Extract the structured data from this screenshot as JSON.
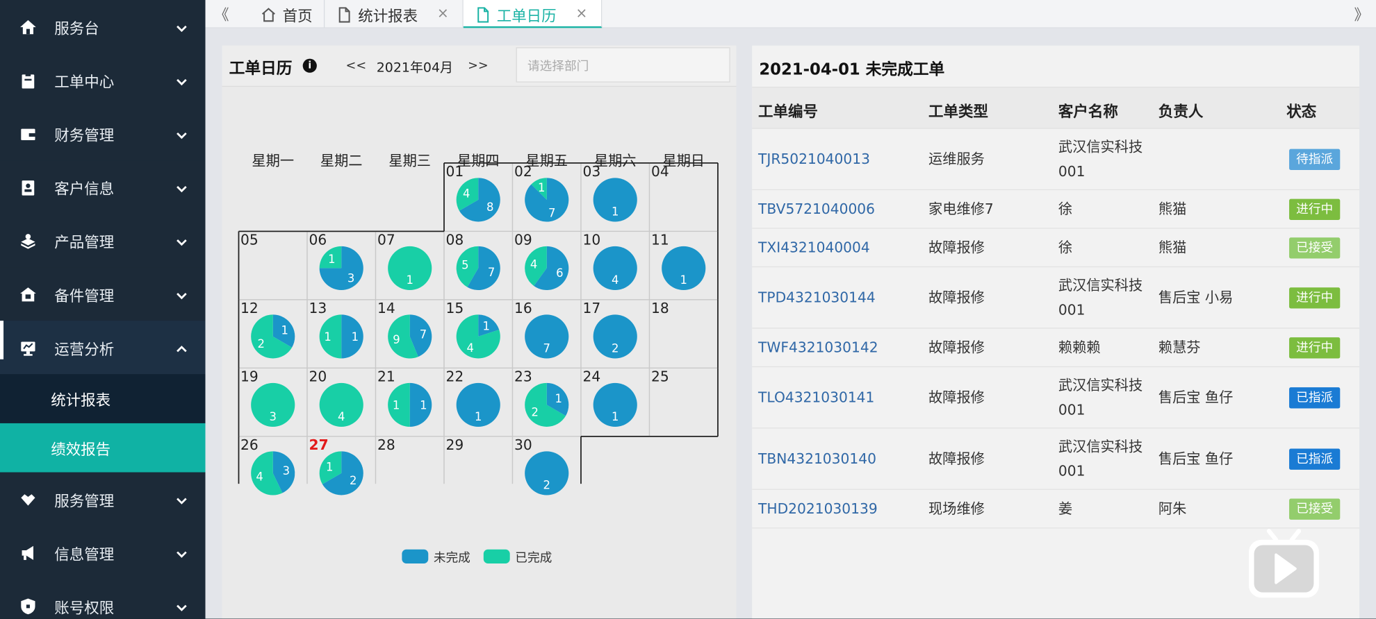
{
  "sidebar": {
    "items": [
      {
        "label": "服务台",
        "icon": "home-icon",
        "expanded": false
      },
      {
        "label": "工单中心",
        "icon": "clipboard-icon",
        "expanded": false
      },
      {
        "label": "财务管理",
        "icon": "wallet-icon",
        "expanded": false
      },
      {
        "label": "客户信息",
        "icon": "contact-card-icon",
        "expanded": false
      },
      {
        "label": "产品管理",
        "icon": "box-icon",
        "expanded": false
      },
      {
        "label": "备件管理",
        "icon": "warehouse-icon",
        "expanded": false
      },
      {
        "label": "运营分析",
        "icon": "monitor-chart-icon",
        "expanded": true
      }
    ],
    "sub_items": [
      {
        "label": "统计报表",
        "active": false
      },
      {
        "label": "绩效报告",
        "active": true
      }
    ],
    "items_after": [
      {
        "label": "服务管理",
        "icon": "handshake-icon",
        "expanded": false
      },
      {
        "label": "信息管理",
        "icon": "megaphone-icon",
        "expanded": false
      },
      {
        "label": "账号权限",
        "icon": "shield-icon",
        "expanded": false
      }
    ]
  },
  "tabs": [
    {
      "label": "首页",
      "icon": "home-outline-icon",
      "closable": false,
      "active": false
    },
    {
      "label": "统计报表",
      "icon": "file-icon",
      "closable": true,
      "active": false
    },
    {
      "label": "工单日历",
      "icon": "file-icon",
      "closable": true,
      "active": true
    }
  ],
  "tab_close_glyph": "×",
  "tab_scroll_left": "《",
  "tab_scroll_right": "》",
  "calendar": {
    "title": "工单日历",
    "prev": "<<",
    "next": ">>",
    "month": "2021年04月",
    "dept_placeholder": "请选择部门",
    "weekdays": [
      "星期一",
      "星期二",
      "星期三",
      "星期四",
      "星期五",
      "星期六",
      "星期日"
    ],
    "first_weekday_index": 3,
    "today": "27",
    "days": [
      {
        "day": "01",
        "incomplete": 8,
        "complete": 4
      },
      {
        "day": "02",
        "incomplete": 7,
        "complete": 1
      },
      {
        "day": "03",
        "incomplete": 1,
        "complete": 0
      },
      {
        "day": "04",
        "incomplete": 0,
        "complete": 0
      },
      {
        "day": "05",
        "incomplete": 0,
        "complete": 0
      },
      {
        "day": "06",
        "incomplete": 3,
        "complete": 1
      },
      {
        "day": "07",
        "incomplete": 0,
        "complete": 1
      },
      {
        "day": "08",
        "incomplete": 7,
        "complete": 5
      },
      {
        "day": "09",
        "incomplete": 6,
        "complete": 4
      },
      {
        "day": "10",
        "incomplete": 4,
        "complete": 0
      },
      {
        "day": "11",
        "incomplete": 1,
        "complete": 0
      },
      {
        "day": "12",
        "incomplete": 1,
        "complete": 2
      },
      {
        "day": "13",
        "incomplete": 1,
        "complete": 1
      },
      {
        "day": "14",
        "incomplete": 7,
        "complete": 9
      },
      {
        "day": "15",
        "incomplete": 1,
        "complete": 4
      },
      {
        "day": "16",
        "incomplete": 7,
        "complete": 0
      },
      {
        "day": "17",
        "incomplete": 2,
        "complete": 0
      },
      {
        "day": "18",
        "incomplete": 0,
        "complete": 0
      },
      {
        "day": "19",
        "incomplete": 0,
        "complete": 3
      },
      {
        "day": "20",
        "incomplete": 0,
        "complete": 4
      },
      {
        "day": "21",
        "incomplete": 1,
        "complete": 1
      },
      {
        "day": "22",
        "incomplete": 1,
        "complete": 0
      },
      {
        "day": "23",
        "incomplete": 1,
        "complete": 2
      },
      {
        "day": "24",
        "incomplete": 1,
        "complete": 0
      },
      {
        "day": "25",
        "incomplete": 0,
        "complete": 0
      },
      {
        "day": "26",
        "incomplete": 3,
        "complete": 4
      },
      {
        "day": "27",
        "incomplete": 2,
        "complete": 1
      },
      {
        "day": "28",
        "incomplete": 0,
        "complete": 0
      },
      {
        "day": "29",
        "incomplete": 0,
        "complete": 0
      },
      {
        "day": "30",
        "incomplete": 2,
        "complete": 0
      }
    ],
    "legend": [
      {
        "label": "未完成",
        "color": "#1b95c9"
      },
      {
        "label": "已完成",
        "color": "#18cfa6"
      }
    ]
  },
  "orders": {
    "title": "2021-04-01 未完成工单",
    "columns": [
      "工单编号",
      "工单类型",
      "客户名称",
      "负责人",
      "状态"
    ],
    "rows": [
      {
        "id": "TJR5021040013",
        "type": "运维服务",
        "customer": [
          "武汉信实科技",
          "001"
        ],
        "owner": "",
        "status": "待指派",
        "status_color": "#5aa6dc"
      },
      {
        "id": "TBV5721040006",
        "type": "家电维修7",
        "customer": [
          "徐"
        ],
        "owner": "熊猫",
        "status": "进行中",
        "status_color": "#7cbd3f"
      },
      {
        "id": "TXI4321040004",
        "type": "故障报修",
        "customer": [
          "徐"
        ],
        "owner": "熊猫",
        "status": "已接受",
        "status_color": "#93cd6c"
      },
      {
        "id": "TPD4321030144",
        "type": "故障报修",
        "customer": [
          "武汉信实科技",
          "001"
        ],
        "owner": "售后宝 小易",
        "status": "进行中",
        "status_color": "#7cbd3f"
      },
      {
        "id": "TWF4321030142",
        "type": "故障报修",
        "customer": [
          "赖赖赖"
        ],
        "owner": "赖慧芬",
        "status": "进行中",
        "status_color": "#7cbd3f"
      },
      {
        "id": "TLO4321030141",
        "type": "故障报修",
        "customer": [
          "武汉信实科技",
          "001"
        ],
        "owner": "售后宝 鱼仔",
        "status": "已指派",
        "status_color": "#1a7bd4"
      },
      {
        "id": "TBN4321030140",
        "type": "故障报修",
        "customer": [
          "武汉信实科技",
          "001"
        ],
        "owner": "售后宝 鱼仔",
        "status": "已指派",
        "status_color": "#1a7bd4"
      },
      {
        "id": "THD2021030139",
        "type": "现场维修",
        "customer": [
          "姜"
        ],
        "owner": "阿朱",
        "status": "已接受",
        "status_color": "#93cd6c"
      }
    ]
  },
  "colors": {
    "sidebar_bg": "#1c2a38",
    "sidebar_expanded_bg": "#1d3044",
    "submenu_bg": "#102233",
    "submenu_active_bg": "#10b2a4",
    "tab_active_color": "#1bb3a5",
    "link_color": "#2f67a6",
    "today_color": "#e21b1b"
  }
}
